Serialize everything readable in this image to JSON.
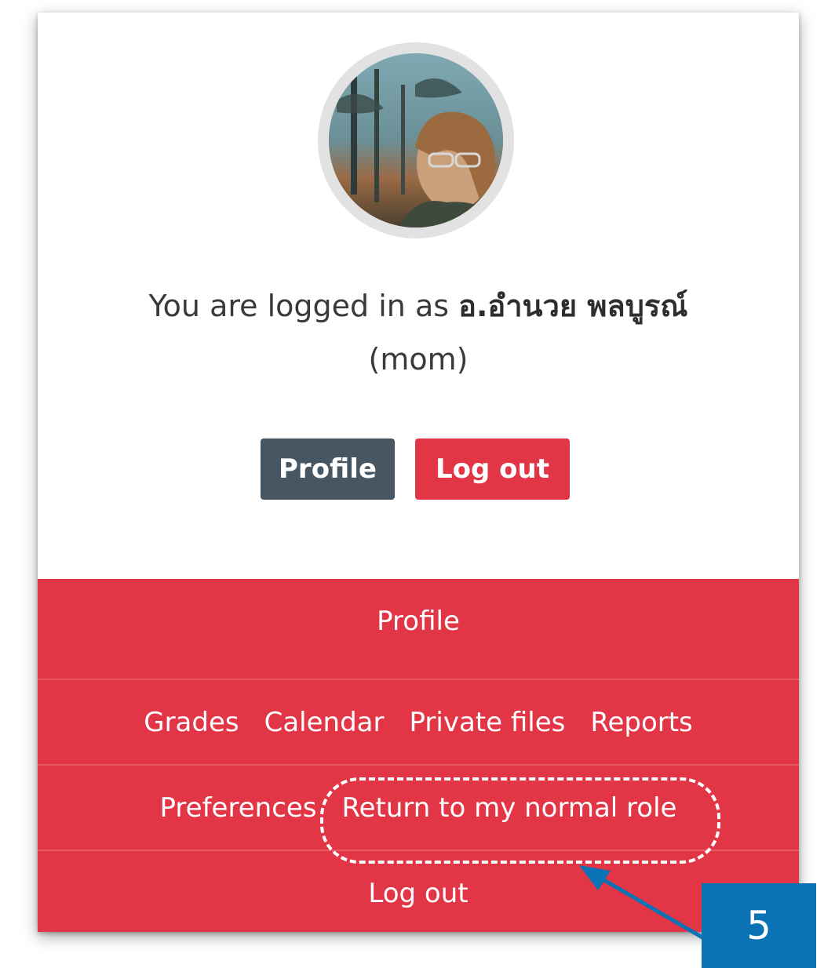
{
  "user_panel": {
    "logged_in_prefix": "You are logged in as",
    "user_name": "อ.อำนวย พลบูรณ์",
    "username_line": "(mom)",
    "profile_button": "Profile",
    "logout_button": "Log out"
  },
  "menu": {
    "row1": [
      "Profile"
    ],
    "row2": [
      "Grades",
      "Calendar",
      "Private files",
      "Reports"
    ],
    "row3": [
      "Preferences",
      "Return to my normal role"
    ],
    "row4": [
      "Log out"
    ]
  },
  "annotation": {
    "step_number": "5"
  },
  "colors": {
    "menu_bg": "#e23546",
    "profile_button_bg": "#465663",
    "callout_bg": "#0b72b5"
  }
}
